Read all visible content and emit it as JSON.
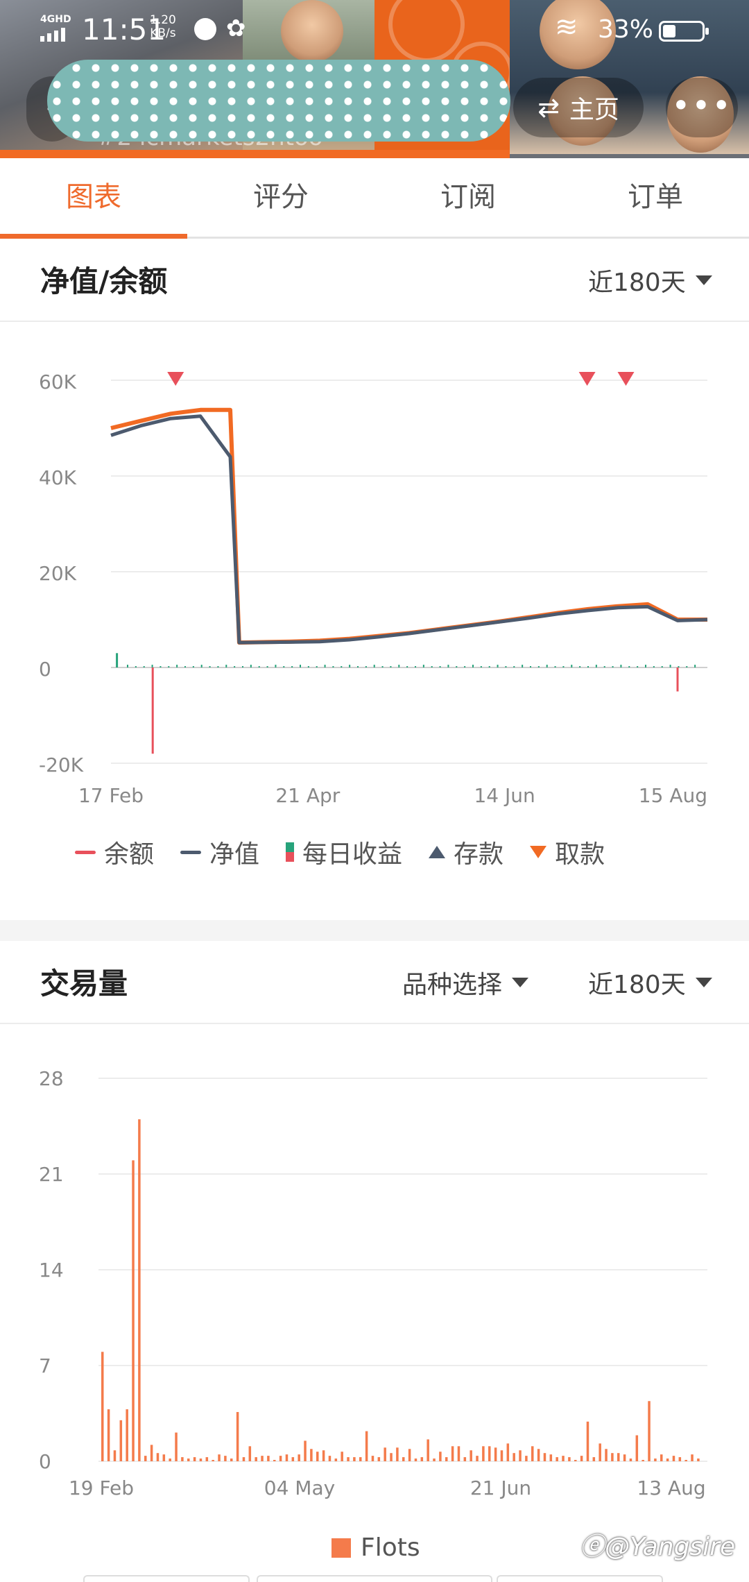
{
  "status_bar": {
    "network": "4GHD",
    "time": "11:51",
    "speed_value": "1.20",
    "speed_unit": "KB/s",
    "battery_percent": "33%"
  },
  "header": {
    "title_partial": "#2  icmarkets2ntoo",
    "home_label": "主页",
    "more_label": "•••"
  },
  "tabs": [
    {
      "label": "图表",
      "active": true
    },
    {
      "label": "评分",
      "active": false
    },
    {
      "label": "订阅",
      "active": false
    },
    {
      "label": "订单",
      "active": false
    }
  ],
  "equity_section": {
    "title": "净值/余额",
    "period": "近180天"
  },
  "volume_section": {
    "title": "交易量",
    "symbol_select": "品种选择",
    "period": "近180天"
  },
  "colors": {
    "accent": "#ef6a2c",
    "balance": "#e8505b",
    "equity": "#4c5a6e",
    "volume": "#f47b4b",
    "daily_profit_pos": "#27a37b"
  },
  "chart_data": [
    {
      "type": "line",
      "x_tick_labels": [
        "17 Feb",
        "21 Apr",
        "14 Jun",
        "15 Aug"
      ],
      "y_tick_labels": [
        "60K",
        "40K",
        "20K",
        "0",
        "-20K"
      ],
      "ylim": [
        -20000,
        60000
      ],
      "legend": [
        "余额",
        "净值",
        "每日收益",
        "存款",
        "取款"
      ],
      "series": [
        {
          "name": "余额",
          "values": [
            50000,
            51500,
            53000,
            53800,
            53800,
            5200,
            5400,
            5600,
            6000,
            6600,
            7200,
            8000,
            8800,
            9600,
            10500,
            11400,
            12200,
            12800,
            13200,
            10000,
            10000
          ]
        },
        {
          "name": "净值",
          "values": [
            48500,
            50500,
            52000,
            52500,
            44000,
            5200,
            5300,
            5400,
            5800,
            6400,
            7100,
            7900,
            8700,
            9500,
            10300,
            11200,
            11900,
            12500,
            12700,
            9800,
            10000
          ]
        }
      ],
      "withdrawals_at_index": [
        2.4,
        16.2,
        17.5
      ],
      "daily_profit_spikes": [
        {
          "at": 0.2,
          "value": 3000
        },
        {
          "at": 1.4,
          "value": -18000
        },
        {
          "at": 19.0,
          "value": -5000
        }
      ]
    },
    {
      "type": "bar",
      "x_tick_labels": [
        "19 Feb",
        "04 May",
        "21 Jun",
        "13 Aug"
      ],
      "y_tick_labels": [
        "28",
        "21",
        "14",
        "7",
        "0"
      ],
      "ylim": [
        0,
        28
      ],
      "legend": [
        "Flots"
      ],
      "series": [
        {
          "name": "Flots",
          "values": [
            8,
            3.8,
            0.8,
            3,
            3.8,
            22,
            25,
            0.4,
            1.2,
            0.6,
            0.5,
            0.2,
            2.1,
            0.3,
            0.2,
            0.3,
            0.2,
            0.3,
            0.1,
            0.5,
            0.4,
            0.2,
            3.6,
            0.3,
            1.1,
            0.3,
            0.4,
            0.4,
            0.1,
            0.4,
            0.5,
            0.3,
            0.5,
            1.5,
            0.9,
            0.7,
            0.8,
            0.4,
            0.2,
            0.7,
            0.3,
            0.3,
            0.3,
            2.2,
            0.4,
            0.3,
            1.0,
            0.6,
            1.0,
            0.3,
            0.9,
            0.2,
            0.3,
            1.6,
            0.2,
            0.7,
            0.3,
            1.1,
            1.1,
            0.3,
            0.8,
            0.4,
            1.1,
            1.1,
            1.0,
            0.8,
            1.3,
            0.6,
            0.8,
            0.4,
            1.1,
            0.9,
            0.6,
            0.5,
            0.3,
            0.4,
            0.3,
            0.1,
            0.4,
            2.9,
            0.3,
            1.3,
            0.9,
            0.6,
            0.6,
            0.5,
            0.2,
            1.9,
            0.1,
            4.4,
            0.2,
            0.5,
            0.2,
            0.4,
            0.3,
            0.1,
            0.5,
            0.2
          ]
        }
      ]
    }
  ]
}
